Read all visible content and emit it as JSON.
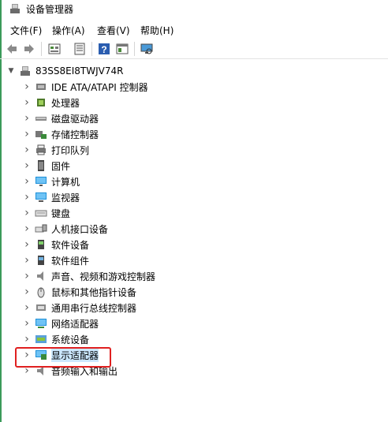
{
  "window": {
    "title": "设备管理器"
  },
  "menu": [
    "文件(F)",
    "操作(A)",
    "查看(V)",
    "帮助(H)"
  ],
  "toolbar": [
    "back-icon",
    "forward-icon",
    "properties-list-icon",
    "properties-icon",
    "help-icon",
    "view-icon",
    "monitor-icon"
  ],
  "tree": {
    "root": "83SS8EI8TWJV74R",
    "items": [
      {
        "label": "IDE ATA/ATAPI 控制器",
        "icon": "ide-controller-icon",
        "name": "node-ide"
      },
      {
        "label": "处理器",
        "icon": "processor-icon",
        "name": "node-processor"
      },
      {
        "label": "磁盘驱动器",
        "icon": "disk-drive-icon",
        "name": "node-disk"
      },
      {
        "label": "存储控制器",
        "icon": "storage-controller-icon",
        "name": "node-storage"
      },
      {
        "label": "打印队列",
        "icon": "printer-icon",
        "name": "node-print-queue"
      },
      {
        "label": "固件",
        "icon": "firmware-icon",
        "name": "node-firmware"
      },
      {
        "label": "计算机",
        "icon": "computer-icon",
        "name": "node-computer"
      },
      {
        "label": "监视器",
        "icon": "monitor-icon",
        "name": "node-monitor"
      },
      {
        "label": "键盘",
        "icon": "keyboard-icon",
        "name": "node-keyboard"
      },
      {
        "label": "人机接口设备",
        "icon": "hid-icon",
        "name": "node-hid"
      },
      {
        "label": "软件设备",
        "icon": "software-device-icon",
        "name": "node-software-device"
      },
      {
        "label": "软件组件",
        "icon": "software-component-icon",
        "name": "node-software-component"
      },
      {
        "label": "声音、视频和游戏控制器",
        "icon": "sound-icon",
        "name": "node-sound"
      },
      {
        "label": "鼠标和其他指针设备",
        "icon": "mouse-icon",
        "name": "node-mouse"
      },
      {
        "label": "通用串行总线控制器",
        "icon": "usb-icon",
        "name": "node-usb"
      },
      {
        "label": "网络适配器",
        "icon": "network-icon",
        "name": "node-network"
      },
      {
        "label": "系统设备",
        "icon": "system-device-icon",
        "name": "node-system"
      },
      {
        "label": "显示适配器",
        "icon": "display-adapter-icon",
        "name": "node-display-adapter"
      },
      {
        "label": "音频输入和输出",
        "icon": "audio-io-icon",
        "name": "node-audio-io"
      }
    ]
  },
  "colors": {
    "highlight": "#e02020",
    "selection": "#cce8ff",
    "accent": "#3c9a5a"
  }
}
